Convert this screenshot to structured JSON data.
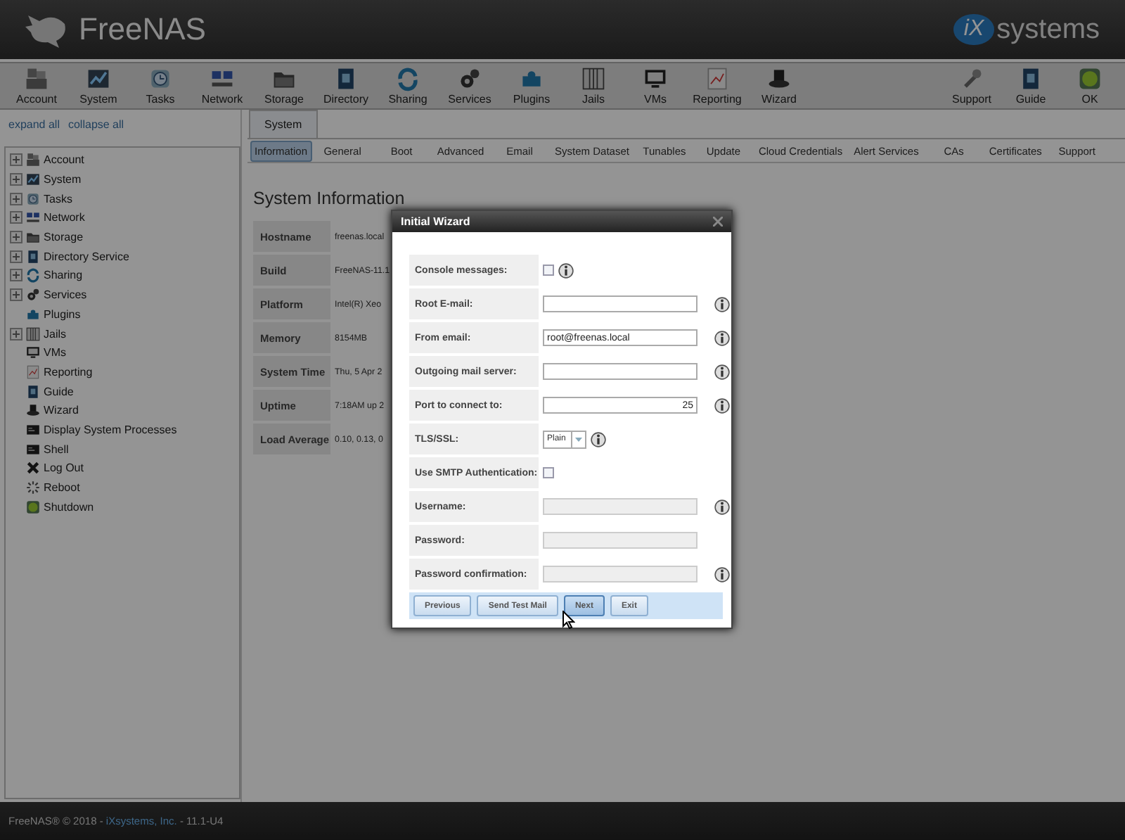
{
  "header": {
    "brand": "FreeNAS",
    "vendor": "systems",
    "vendor_mark": "iX"
  },
  "toolbar": {
    "left": [
      "Account",
      "System",
      "Tasks",
      "Network",
      "Storage",
      "Directory",
      "Sharing",
      "Services",
      "Plugins",
      "Jails",
      "VMs",
      "Reporting",
      "Wizard"
    ],
    "right": [
      "Support",
      "Guide",
      "OK"
    ]
  },
  "sidebar": {
    "links": [
      "expand all",
      "collapse all"
    ],
    "items": [
      {
        "label": "Account",
        "expandable": true
      },
      {
        "label": "System",
        "expandable": true
      },
      {
        "label": "Tasks",
        "expandable": true
      },
      {
        "label": "Network",
        "expandable": true
      },
      {
        "label": "Storage",
        "expandable": true
      },
      {
        "label": "Directory Service",
        "expandable": true
      },
      {
        "label": "Sharing",
        "expandable": true
      },
      {
        "label": "Services",
        "expandable": true
      },
      {
        "label": "Plugins",
        "expandable": false
      },
      {
        "label": "Jails",
        "expandable": true
      },
      {
        "label": "VMs",
        "expandable": false
      },
      {
        "label": "Reporting",
        "expandable": false
      },
      {
        "label": "Guide",
        "expandable": false
      },
      {
        "label": "Wizard",
        "expandable": false
      },
      {
        "label": "Display System Processes",
        "expandable": false
      },
      {
        "label": "Shell",
        "expandable": false
      },
      {
        "label": "Log Out",
        "expandable": false
      },
      {
        "label": "Reboot",
        "expandable": false
      },
      {
        "label": "Shutdown",
        "expandable": false
      }
    ]
  },
  "tabs": [
    {
      "label": "System",
      "selected": true
    }
  ],
  "subtabs": [
    {
      "label": "Information",
      "selected": true
    },
    {
      "label": "General",
      "selected": false
    },
    {
      "label": "Boot",
      "selected": false
    },
    {
      "label": "Advanced",
      "selected": false
    },
    {
      "label": "Email",
      "selected": false
    },
    {
      "label": "System Dataset",
      "selected": false
    },
    {
      "label": "Tunables",
      "selected": false
    },
    {
      "label": "Update",
      "selected": false
    },
    {
      "label": "Cloud Credentials",
      "selected": false
    },
    {
      "label": "Alert Services",
      "selected": false
    },
    {
      "label": "CAs",
      "selected": false
    },
    {
      "label": "Certificates",
      "selected": false
    },
    {
      "label": "Support",
      "selected": false
    }
  ],
  "info": {
    "title": "System Information",
    "rows": [
      {
        "label": "Hostname",
        "value": "freenas.local"
      },
      {
        "label": "Build",
        "value": "FreeNAS-11.1"
      },
      {
        "label": "Platform",
        "value": "Intel(R) Xeo"
      },
      {
        "label": "Memory",
        "value": "8154MB"
      },
      {
        "label": "System Time",
        "value": "Thu, 5 Apr 2"
      },
      {
        "label": "Uptime",
        "value": "7:18AM up 2"
      },
      {
        "label": "Load Average",
        "value": "0.10, 0.13, 0"
      }
    ]
  },
  "dialog": {
    "title": "Initial Wizard",
    "fields": [
      {
        "label": "Console messages:",
        "kind": "checkbox",
        "checked": false,
        "info": true
      },
      {
        "label": "Root E-mail:",
        "kind": "text",
        "disabled": false,
        "info": true
      },
      {
        "label": "From email:",
        "kind": "text",
        "value": "root@freenas.local",
        "disabled": false,
        "info": true
      },
      {
        "label": "Outgoing mail server:",
        "kind": "text",
        "disabled": false,
        "info": true
      },
      {
        "label": "Port to connect to:",
        "kind": "number",
        "value": "25",
        "disabled": false,
        "info": true
      },
      {
        "label": "TLS/SSL:",
        "kind": "select",
        "value": "Plain",
        "info": true
      },
      {
        "label": "Use SMTP Authentication:",
        "kind": "checkbox",
        "checked": false,
        "info": false
      },
      {
        "label": "Username:",
        "kind": "text",
        "disabled": true,
        "info": true
      },
      {
        "label": "Password:",
        "kind": "text",
        "disabled": true,
        "info": false
      },
      {
        "label": "Password confirmation:",
        "kind": "text",
        "disabled": true,
        "info": true
      }
    ],
    "buttons": [
      {
        "label": "Previous",
        "selected": false
      },
      {
        "label": "Send Test Mail",
        "selected": false
      },
      {
        "label": "Next",
        "selected": true
      },
      {
        "label": "Exit",
        "selected": false
      }
    ]
  },
  "footer": {
    "before": "FreeNAS® © 2018 - ",
    "link": "iXsystems, Inc.",
    "after": " - 11.1-U4"
  }
}
